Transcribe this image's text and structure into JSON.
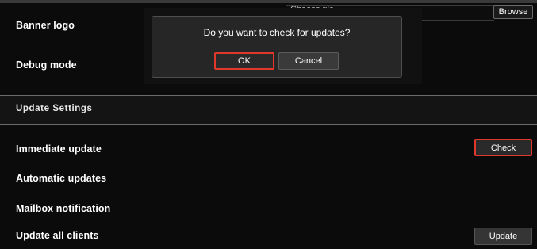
{
  "settings": {
    "banner_logo_label": "Banner logo",
    "banner_logo_placeholder": "Choose file",
    "browse_label": "Browse",
    "debug_mode_label": "Debug mode"
  },
  "update_section": {
    "title": "Update Settings",
    "immediate_update_label": "Immediate update",
    "check_label": "Check",
    "automatic_updates_label": "Automatic updates",
    "mailbox_notification_label": "Mailbox notification",
    "update_all_clients_label": "Update all clients",
    "update_label": "Update"
  },
  "dialog": {
    "message": "Do you want to check for updates?",
    "ok_label": "OK",
    "cancel_label": "Cancel"
  },
  "colors": {
    "highlight": "#e0382a",
    "background": "#0b0b0b",
    "button": "#2e2e2e"
  }
}
